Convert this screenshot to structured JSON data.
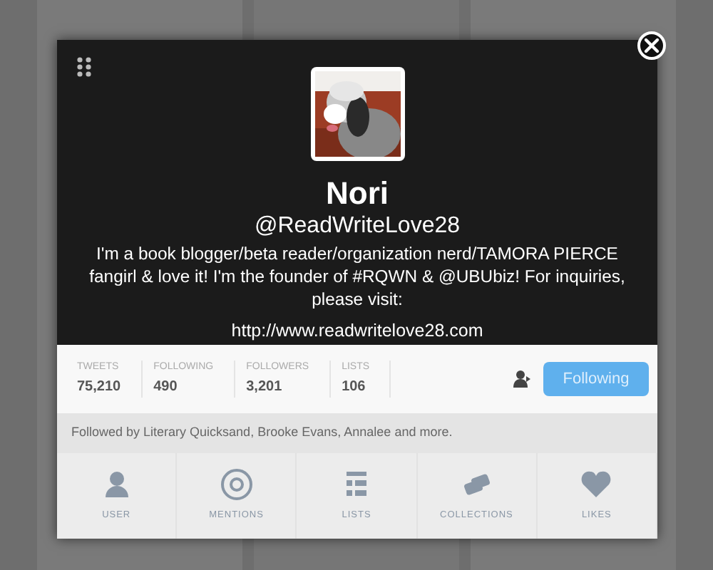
{
  "profile": {
    "name": "Nori",
    "handle": "@ReadWriteLove28",
    "bio": "I'm a book blogger/beta reader/organization nerd/TAMORA PIERCE fangirl & love it! I'm the founder of #RQWN & @UBUbiz! For inquiries, please visit:",
    "url": "http://www.readwritelove28.com"
  },
  "stats": [
    {
      "label": "TWEETS",
      "value": "75,210"
    },
    {
      "label": "FOLLOWING",
      "value": "490"
    },
    {
      "label": "FOLLOWERS",
      "value": "3,201"
    },
    {
      "label": "LISTS",
      "value": "106"
    }
  ],
  "follow_button": {
    "label": "Following",
    "selected": true
  },
  "followed_by": [
    {
      "kind": "text",
      "text": "Followed by"
    },
    {
      "kind": "link",
      "text": "Literary Quicksand"
    },
    {
      "kind": "text",
      "text": ","
    },
    {
      "kind": "link",
      "text": "Brooke Evans"
    },
    {
      "kind": "text",
      "text": ","
    },
    {
      "kind": "link",
      "text": "Annalee"
    },
    {
      "kind": "text",
      "text": "and"
    },
    {
      "kind": "link",
      "text": "more."
    }
  ],
  "nav": [
    {
      "kind": "user",
      "label": "USER"
    },
    {
      "kind": "mentions",
      "label": "MENTIONS"
    },
    {
      "kind": "lists",
      "label": "LISTS"
    },
    {
      "kind": "collections",
      "label": "COLLECTIONS"
    },
    {
      "kind": "likes",
      "label": "LIKES"
    }
  ]
}
